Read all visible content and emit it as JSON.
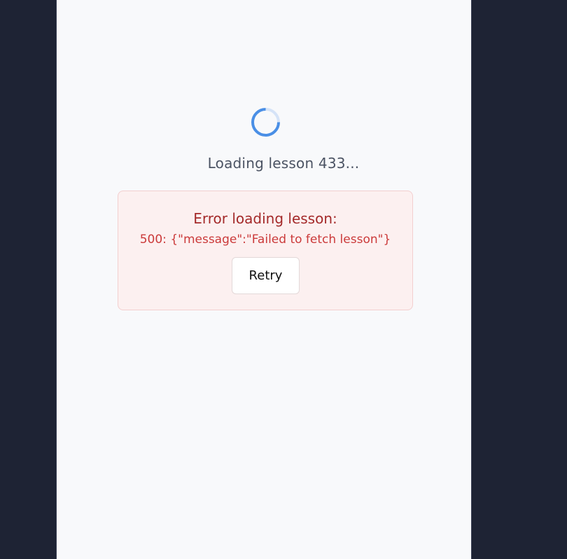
{
  "loading": {
    "text": "Loading lesson 433..."
  },
  "error": {
    "title": "Error loading lesson:",
    "message": "500: {\"message\":\"Failed to fetch lesson\"}",
    "retry_label": "Retry"
  },
  "colors": {
    "background": "#1e2334",
    "panel": "#f8f9fb",
    "spinner_accent": "#4a8fe6",
    "error_title": "#a42a2a",
    "error_text": "#cb3a3a",
    "error_box_bg": "#fcf0f0",
    "error_box_border": "#f3cfcf"
  },
  "icons": {
    "spinner": "loading-spinner-icon"
  }
}
